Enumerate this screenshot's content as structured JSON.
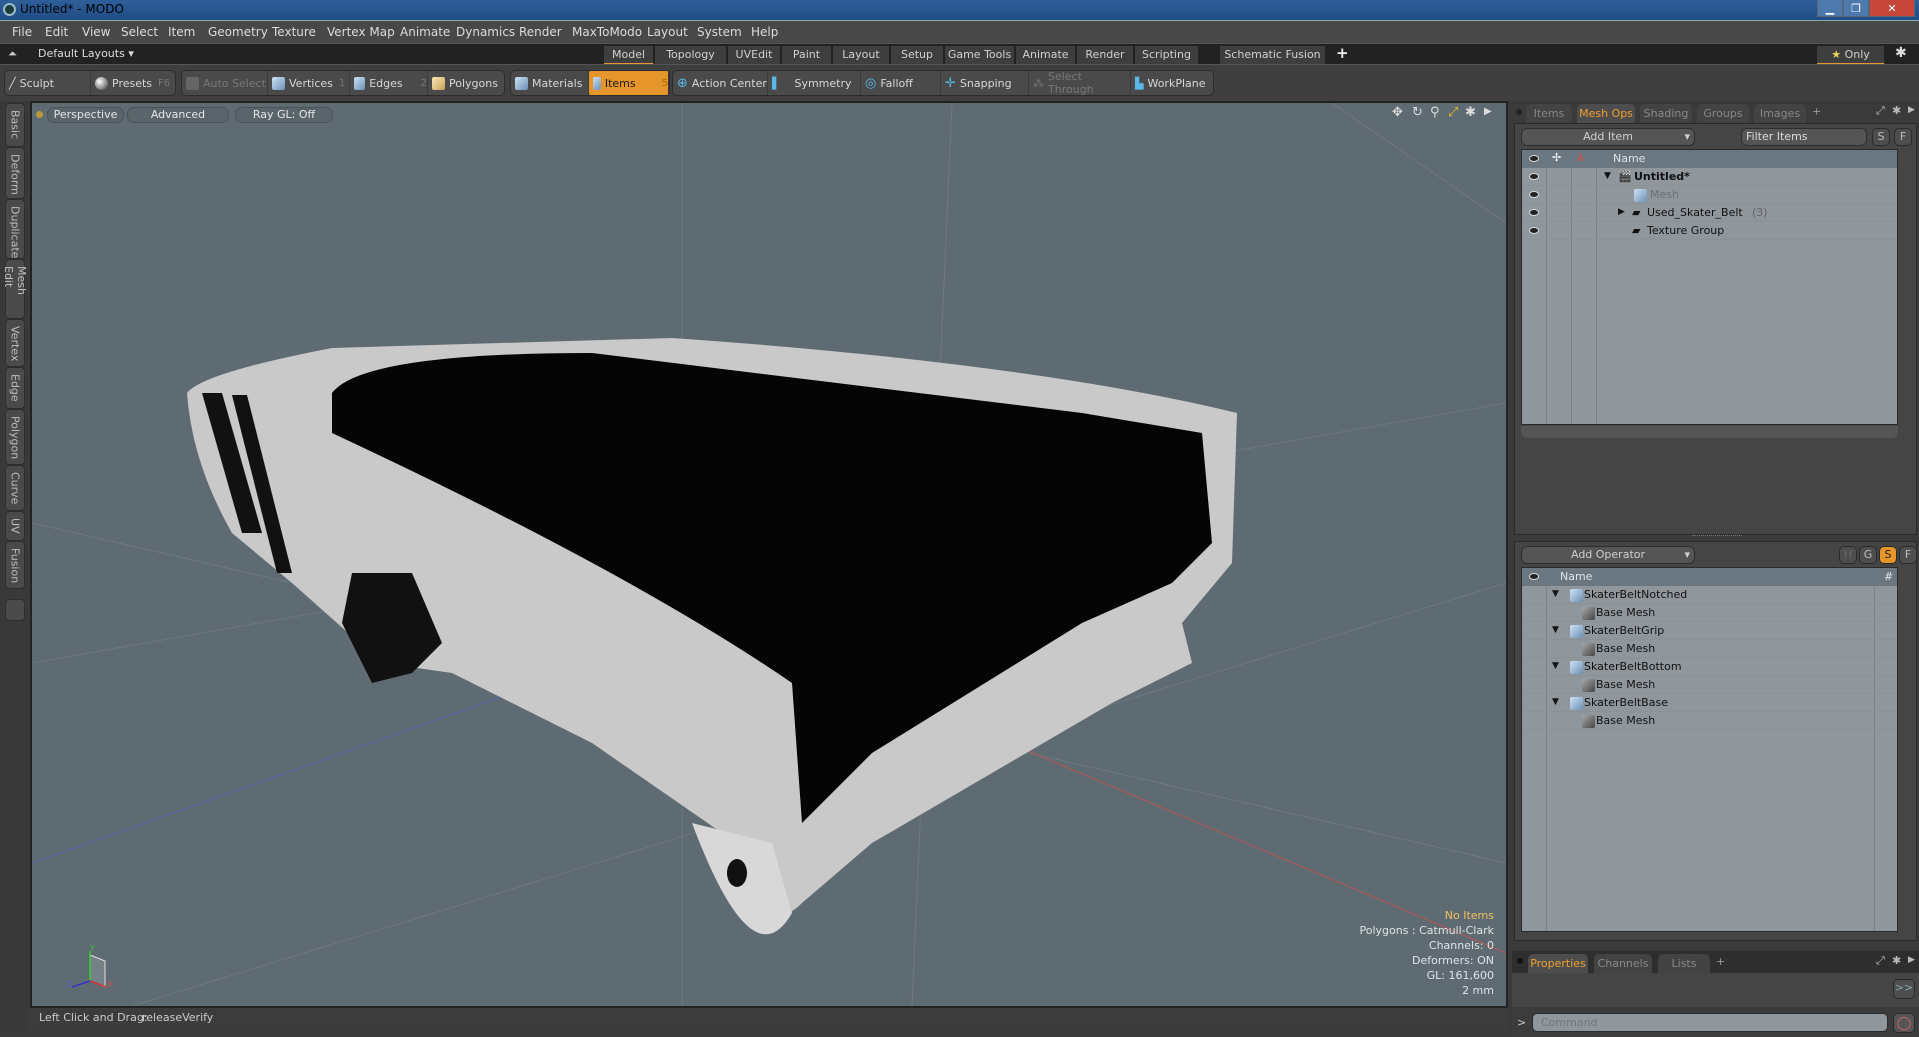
{
  "window": {
    "title": "Untitled* - MODO",
    "controls": [
      "minimize",
      "restore",
      "close"
    ]
  },
  "menu": [
    "File",
    "Edit",
    "View",
    "Select",
    "Item",
    "Geometry",
    "Texture",
    "Vertex Map",
    "Animate",
    "Dynamics",
    "Render",
    "MaxToModo",
    "Layout",
    "System",
    "Help"
  ],
  "layout_bar": {
    "layouts_label": "Default Layouts",
    "tabs": [
      "Model",
      "Topology",
      "UVEdit",
      "Paint",
      "Layout",
      "Setup",
      "Game Tools",
      "Animate",
      "Render",
      "Scripting",
      "Schematic Fusion"
    ],
    "active_tab": "Model",
    "add_tab": "+",
    "only_label": "Only"
  },
  "toolbar": {
    "sculpt": "Sculpt",
    "presets": "Presets",
    "presets_key": "F6",
    "auto_select": "Auto Select",
    "vertices": "Vertices",
    "vertices_key": "1",
    "edges": "Edges",
    "edges_key": "2",
    "polygons": "Polygons",
    "materials": "Materials",
    "items": "Items",
    "items_key": "5",
    "action_center": "Action Center",
    "symmetry": "Symmetry",
    "falloff": "Falloff",
    "snapping": "Snapping",
    "select_through": "Select Through",
    "workplane": "WorkPlane"
  },
  "left_tabs": [
    "Basic",
    "Deform",
    "Duplicate",
    "Mesh Edit",
    "Vertex",
    "Edge",
    "Polygon",
    "Curve",
    "UV",
    "Fusion"
  ],
  "viewport": {
    "view_mode": "Perspective",
    "shading": "Advanced",
    "raygl": "Ray GL: Off",
    "hud": {
      "selection": "No Items",
      "polygons": "Polygons : Catmull-Clark",
      "channels": "Channels: 0",
      "deformers": "Deformers: ON",
      "gl": "GL: 161,600",
      "scale": "2 mm"
    },
    "axis_labels": {
      "x": "X",
      "y": "Y",
      "z": "Z"
    }
  },
  "status_line": {
    "label": "Left Click and Drag:",
    "value": "releaseVerify"
  },
  "items_panel": {
    "tabs": [
      "Items",
      "Mesh Ops",
      "Shading",
      "Groups",
      "Images"
    ],
    "active_tab": "Mesh Ops",
    "add_item": "Add Item",
    "filter_placeholder": "Filter Items",
    "s_btn": "S",
    "f_btn": "F",
    "column_name": "Name",
    "tree": [
      {
        "name": "Untitled*",
        "level": 0,
        "bold": true,
        "expanded": true
      },
      {
        "name": "Mesh",
        "level": 1,
        "dim": true
      },
      {
        "name": "Used_Skater_Belt",
        "count": "(3)",
        "level": 1,
        "collapsed": true
      },
      {
        "name": "Texture Group",
        "level": 1
      }
    ]
  },
  "meshops_panel": {
    "add_operator": "Add Operator",
    "buttons": [
      "H",
      "G",
      "S",
      "F"
    ],
    "active_button": "S",
    "column_name": "Name",
    "column_hash": "#",
    "tree": [
      {
        "name": "SkaterBeltNotched",
        "child": "Base Mesh"
      },
      {
        "name": "SkaterBeltGrip",
        "child": "Base Mesh"
      },
      {
        "name": "SkaterBeltBottom",
        "child": "Base Mesh"
      },
      {
        "name": "SkaterBeltBase",
        "child": "Base Mesh"
      }
    ]
  },
  "properties_panel": {
    "tabs": [
      "Properties",
      "Channels",
      "Lists"
    ],
    "active_tab": "Properties",
    "expand_btn": ">>"
  },
  "command": {
    "prompt": ">",
    "placeholder": "Command"
  },
  "colors": {
    "accent": "#e6952a",
    "viewport_bg": "#5f6b72",
    "hud_highlight": "#f0c060"
  }
}
